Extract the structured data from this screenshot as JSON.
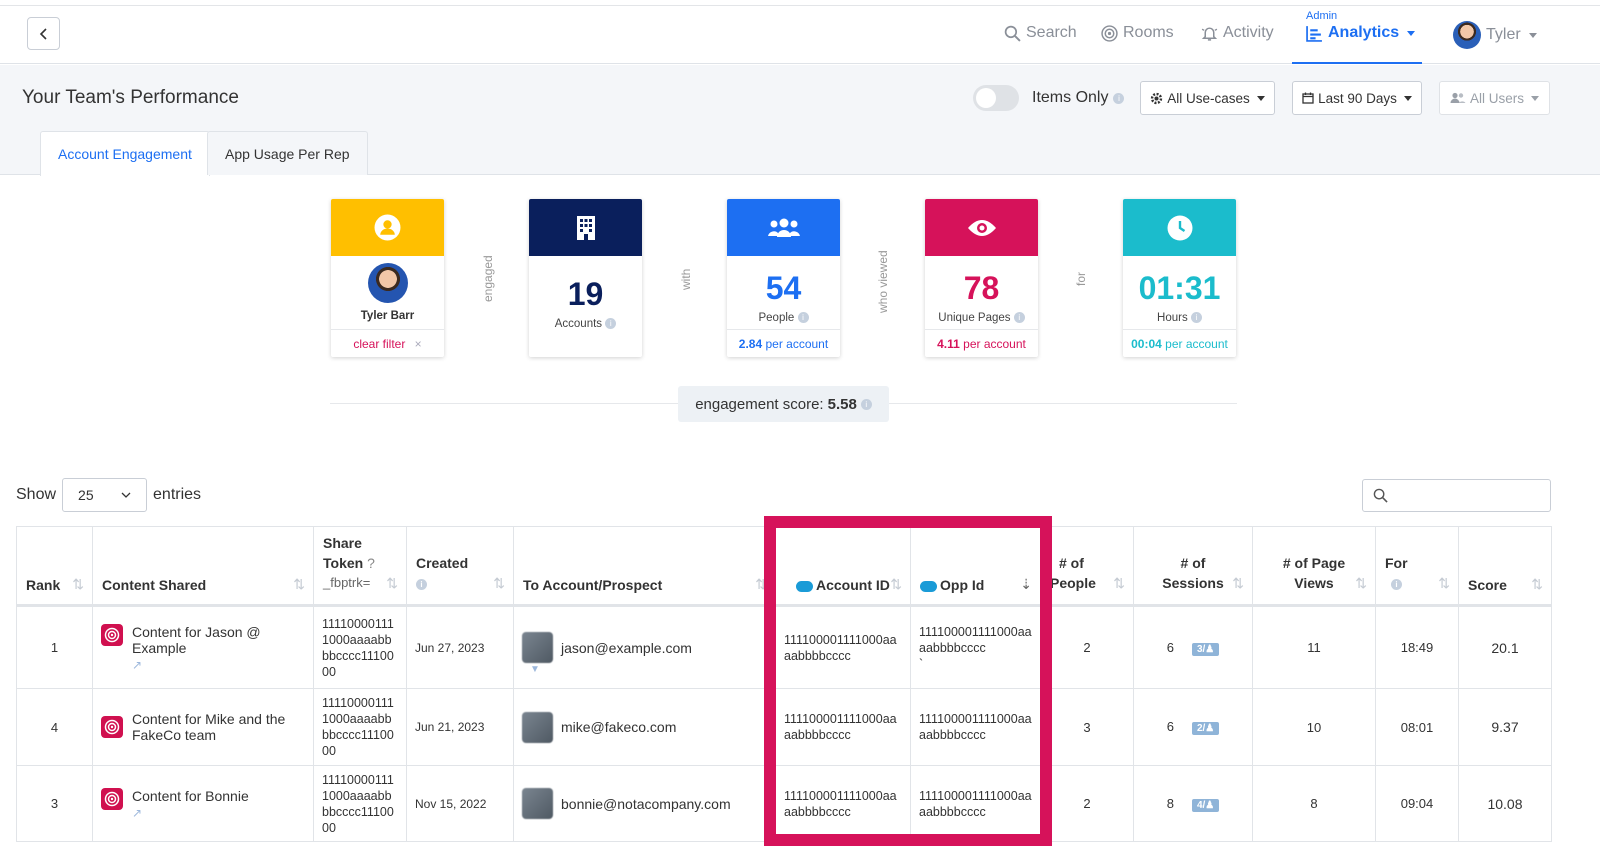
{
  "nav": {
    "search": "Search",
    "rooms": "Rooms",
    "activity": "Activity",
    "admin": "Admin",
    "analytics": "Analytics",
    "user": "Tyler"
  },
  "header": {
    "title": "Your Team's Performance",
    "items_only": "Items Only",
    "use_cases": "All Use-cases",
    "date_range": "Last 90 Days",
    "users": "All Users"
  },
  "tabs": [
    "Account Engagement",
    "App Usage Per Rep"
  ],
  "cards": {
    "user_name": "Tyler Barr",
    "clear_filter": "clear filter",
    "accounts_value": "19",
    "accounts_label": "Accounts",
    "people_value": "54",
    "people_label": "People",
    "people_per": "2.84",
    "pages_value": "78",
    "pages_label": "Unique Pages",
    "pages_per": "4.11",
    "hours_value": "01:31",
    "hours_label": "Hours",
    "hours_per": "00:04",
    "per_account": "per account",
    "colors": {
      "user": "#ffbf00",
      "accounts": "#0a1f5c",
      "people": "#1d6ff2",
      "pages": "#d6125a",
      "hours": "#1bbccc"
    }
  },
  "connectors": [
    "engaged",
    "with",
    "who viewed",
    "for"
  ],
  "engagement": {
    "label": "engagement score:",
    "value": "5.58"
  },
  "table_controls": {
    "show": "Show",
    "entries_value": "25",
    "entries": "entries"
  },
  "columns": {
    "rank": "Rank",
    "content": "Content Shared",
    "token_title": "Share Token",
    "token_q": "?",
    "token_sub": "_fbptrk=",
    "created": "Created",
    "account": "To Account/Prospect",
    "account_id": "Account ID",
    "opp_id": "Opp Id",
    "people_a": "# of",
    "people_b": "People",
    "sessions_a": "# of",
    "sessions_b": "Sessions",
    "views_a": "# of Page",
    "views_b": "Views",
    "for": "For",
    "score": "Score"
  },
  "rows": [
    {
      "rank": "1",
      "content": "Content for Jason @ Example",
      "token": "111100001111000aaaabbbbcccc1110000",
      "created": "Jun 27, 2023",
      "email": "jason@example.com",
      "account_id": "111100001111000aaaabbbbcccc",
      "opp_id": "111100001111000aaaabbbbcccc",
      "opp_extra": "`",
      "people": "2",
      "sessions": "6",
      "badge": "3/",
      "views": "11",
      "for": "18:49",
      "score": "20.1"
    },
    {
      "rank": "4",
      "content": "Content for Mike and the FakeCo team",
      "token": "111100001111000aaaabbbbcccc1110000",
      "created": "Jun 21, 2023",
      "email": "mike@fakeco.com",
      "account_id": "111100001111000aaaabbbbcccc",
      "opp_id": "111100001111000aaaabbbbcccc",
      "opp_extra": "",
      "people": "3",
      "sessions": "6",
      "badge": "2/",
      "views": "10",
      "for": "08:01",
      "score": "9.37"
    },
    {
      "rank": "3",
      "content": "Content for Bonnie",
      "token": "111100001111000aaaabbbbcccc1110000",
      "created": "Nov 15, 2022",
      "email": "bonnie@notacompany.com",
      "account_id": "111100001111000aaaabbbbcccc",
      "opp_id": "111100001111000aaaabbbbcccc",
      "opp_extra": "",
      "people": "2",
      "sessions": "8",
      "badge": "4/",
      "views": "8",
      "for": "09:04",
      "score": "10.08"
    }
  ]
}
